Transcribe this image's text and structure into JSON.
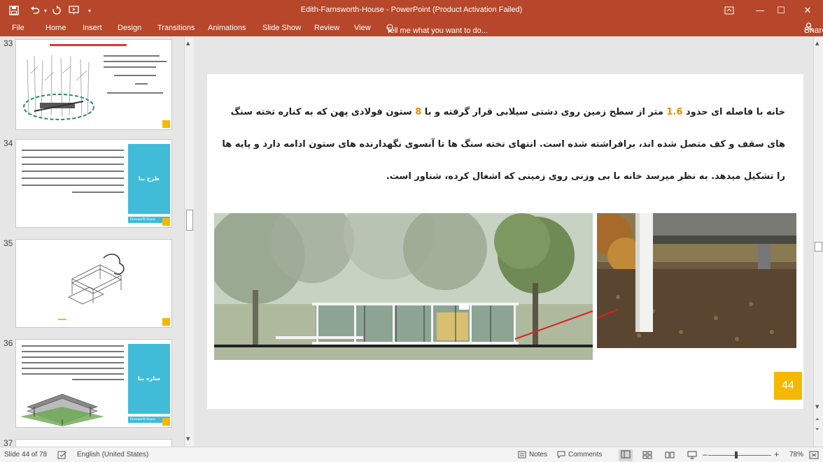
{
  "window": {
    "title": "Edith-Farnsworth-House - PowerPoint (Product Activation Failed)",
    "quick_access": {
      "save": "save-icon",
      "undo": "undo-icon",
      "redo": "redo-icon",
      "start": "start-from-beginning-icon",
      "customize": "customize-icon"
    },
    "controls": {
      "ribbon_display": "ribbon-display-icon",
      "minimize": "—",
      "maximize": "☐",
      "close": "✕"
    }
  },
  "ribbon": {
    "tabs": [
      "File",
      "Home",
      "Insert",
      "Design",
      "Transitions",
      "Animations",
      "Slide Show",
      "Review",
      "View"
    ],
    "tell_me": "Tell me what you want to do...",
    "share": "Share"
  },
  "thumbnails": [
    {
      "number": "33",
      "title": "چه ویژگی ساختمان را خاص و متفاوت می‌کند؟"
    },
    {
      "number": "34",
      "panel_label": "طرح بنا",
      "footer": "Farnsworth House"
    },
    {
      "number": "35"
    },
    {
      "number": "36",
      "panel_label": "سازه بنا",
      "footer": "Farnsworth House"
    },
    {
      "number": "37"
    }
  ],
  "slide": {
    "text_part1": "خانه با فاصله ای حدود ",
    "highlight1": "1.6",
    "text_part2": " متر از سطح زمین روی دشتی سیلابی قرار گرفته و با ",
    "highlight2": "8",
    "text_part3": " ستون فولادی پهن که به کناره تخته سنگ های سقف و کف متصل شده اند، برافراشته شده است. انتهای تخته سنگ ها تا آنسوی نگهدارنده های ستون ادامه دارد و پایه ها را تشکیل میدهد. به نظر میرسد خانه با بی وزنی روی زمینی که اشغال کرده، شناور است.",
    "page_number": "44"
  },
  "status": {
    "slide_info": "Slide 44 of 78",
    "language": "English (United States)",
    "notes": "Notes",
    "comments": "Comments",
    "zoom": "78%"
  },
  "colors": {
    "accent": "#b7472a",
    "highlight": "#f08a00",
    "badge": "#f5b800",
    "panel": "#40bcd8"
  }
}
